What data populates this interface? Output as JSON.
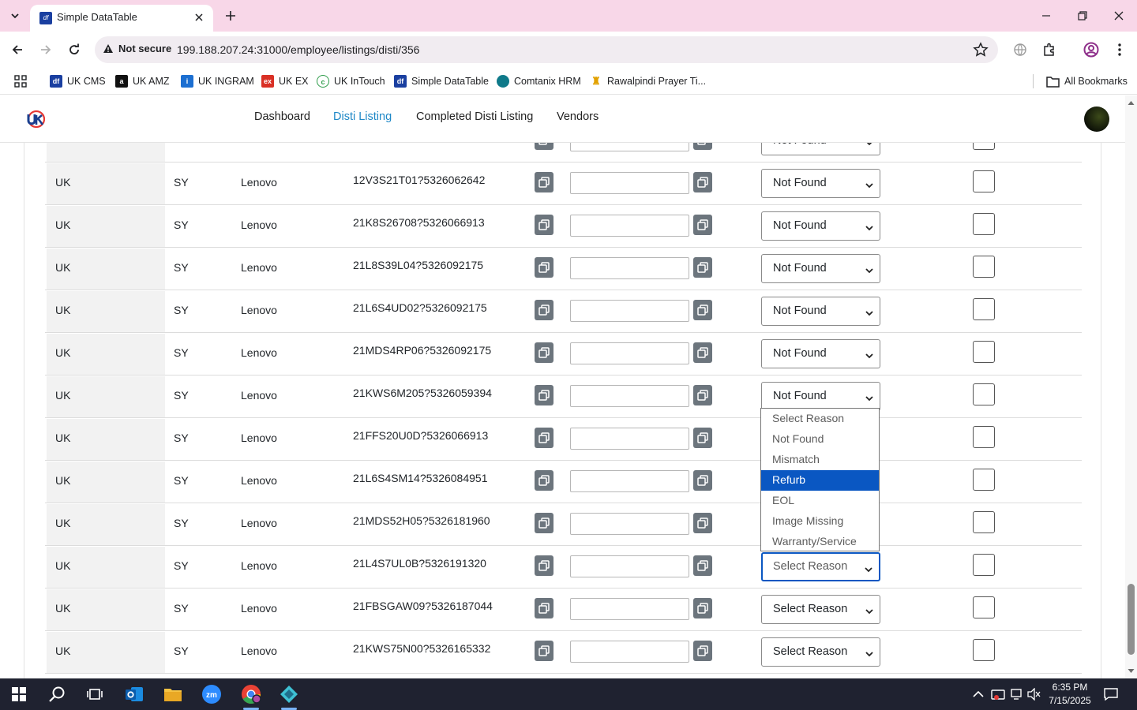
{
  "browser": {
    "tab_title": "Simple DataTable",
    "security_label": "Not secure",
    "url": "199.188.207.24:31000/employee/listings/disti/356"
  },
  "bookmarks": [
    {
      "label": "UK CMS",
      "icon": "uk-cms-icon",
      "color": "#1a3fa0"
    },
    {
      "label": "UK AMZ",
      "icon": "amazon-icon",
      "color": "#111111"
    },
    {
      "label": "UK INGRAM",
      "icon": "ingram-icon",
      "color": "#1c6fd1"
    },
    {
      "label": "UK EX",
      "icon": "ex-icon",
      "color": "#d93025"
    },
    {
      "label": "UK InTouch",
      "icon": "intouch-icon",
      "color": "#2e9c4a"
    },
    {
      "label": "Simple DataTable",
      "icon": "datatable-icon",
      "color": "#1a3fa0"
    },
    {
      "label": "Comtanix HRM",
      "icon": "comtanix-icon",
      "color": "#0f7a8a"
    },
    {
      "label": "Rawalpindi Prayer Ti...",
      "icon": "prayer-icon",
      "color": "#e2a100"
    }
  ],
  "all_bookmarks_label": "All Bookmarks",
  "app": {
    "nav": [
      {
        "label": "Dashboard",
        "active": false
      },
      {
        "label": "Disti Listing",
        "active": true
      },
      {
        "label": "Completed Disti Listing",
        "active": false
      },
      {
        "label": "Vendors",
        "active": false
      }
    ],
    "accent_color": "#1e88c7"
  },
  "rows": [
    {
      "region": "UK",
      "code": "SY",
      "brand": "Lenovo",
      "part": "12V3S21T01?5326062642",
      "reason": "Not Found"
    },
    {
      "region": "UK",
      "code": "SY",
      "brand": "Lenovo",
      "part": "21K8S26708?5326066913",
      "reason": "Not Found"
    },
    {
      "region": "UK",
      "code": "SY",
      "brand": "Lenovo",
      "part": "21L8S39L04?5326092175",
      "reason": "Not Found"
    },
    {
      "region": "UK",
      "code": "SY",
      "brand": "Lenovo",
      "part": "21L6S4UD02?5326092175",
      "reason": "Not Found"
    },
    {
      "region": "UK",
      "code": "SY",
      "brand": "Lenovo",
      "part": "21MDS4RP06?5326092175",
      "reason": "Not Found"
    },
    {
      "region": "UK",
      "code": "SY",
      "brand": "Lenovo",
      "part": "21KWS6M205?5326059394",
      "reason": "Not Found"
    },
    {
      "region": "UK",
      "code": "SY",
      "brand": "Lenovo",
      "part": "21FFS20U0D?5326066913",
      "reason": ""
    },
    {
      "region": "UK",
      "code": "SY",
      "brand": "Lenovo",
      "part": "21L6S4SM14?5326084951",
      "reason": ""
    },
    {
      "region": "UK",
      "code": "SY",
      "brand": "Lenovo",
      "part": "21MDS52H05?5326181960",
      "reason": ""
    },
    {
      "region": "UK",
      "code": "SY",
      "brand": "Lenovo",
      "part": "21L4S7UL0B?5326191320",
      "reason": "Select Reason"
    },
    {
      "region": "UK",
      "code": "SY",
      "brand": "Lenovo",
      "part": "21FBSGAW09?5326187044",
      "reason": "Select Reason"
    },
    {
      "region": "UK",
      "code": "SY",
      "brand": "Lenovo",
      "part": "21KWS75N00?5326165332",
      "reason": "Select Reason"
    }
  ],
  "partial_top_row": {
    "reason": "Not Found"
  },
  "reason_options": [
    "Select Reason",
    "Not Found",
    "Mismatch",
    "Refurb",
    "EOL",
    "Image Missing",
    "Warranty/Service"
  ],
  "highlighted_option": "Refurb",
  "taskbar": {
    "time": "6:35 PM",
    "date": "7/15/2025"
  }
}
